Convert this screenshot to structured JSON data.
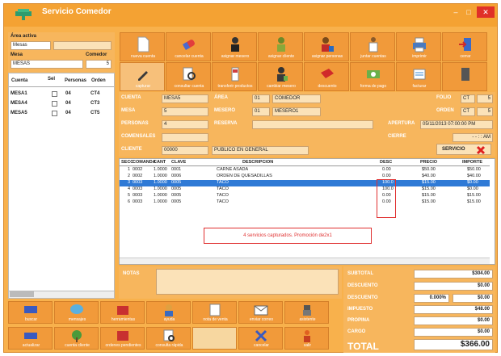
{
  "window": {
    "title": "Servicio Comedor",
    "min_glyph": "–",
    "max_glyph": "□",
    "close_glyph": "✕"
  },
  "left": {
    "area_label": "Área activa",
    "area_value": "Mesas",
    "mesa_label": "Mesa",
    "mesa_value": "MESAS",
    "config_label": "Comedor",
    "config_value": "5",
    "list_headers": [
      "Cuenta",
      "Sel",
      "Personas",
      "Orden"
    ],
    "accounts": [
      {
        "cuenta": "MESA1",
        "personas": "04",
        "orden": "CT4"
      },
      {
        "cuenta": "MESA4",
        "personas": "04",
        "orden": "CT3"
      },
      {
        "cuenta": "MESA5",
        "personas": "04",
        "orden": "CT5"
      }
    ]
  },
  "toolbar": {
    "row1": [
      {
        "name": "nuevo-button",
        "label": "nueva cuenta",
        "icon": "document-icon"
      },
      {
        "name": "borrar-button",
        "label": "cancelar cuenta",
        "icon": "eraser-icon"
      },
      {
        "name": "mesero-button",
        "label": "asignar mesero",
        "icon": "waiter-icon"
      },
      {
        "name": "cliente-button",
        "label": "asignar cliente",
        "icon": "customer-icon"
      },
      {
        "name": "personas-button",
        "label": "asignar personas",
        "icon": "people-icon"
      },
      {
        "name": "juntar-button",
        "label": "juntar cuentas",
        "icon": "merge-icon"
      },
      {
        "name": "imprimir-button",
        "label": "imprimir",
        "icon": "printer-icon"
      },
      {
        "name": "cerrar-button",
        "label": "cerrar",
        "icon": "exit-icon"
      }
    ],
    "row2": [
      {
        "name": "capturar-button",
        "label": "capturar",
        "icon": "pencil-icon"
      },
      {
        "name": "consultar-button",
        "label": "consultar cuenta",
        "icon": "search-doc-icon"
      },
      {
        "name": "transferir-button",
        "label": "transferir productos",
        "icon": "transfer-icon"
      },
      {
        "name": "cambiar-mesero-button",
        "label": "cambiar mesero",
        "icon": "waiter2-icon"
      },
      {
        "name": "descuento-button",
        "label": "descuento",
        "icon": "discount-icon"
      },
      {
        "name": "pagar-button",
        "label": "forma de pago",
        "icon": "payment-icon"
      },
      {
        "name": "factura-button",
        "label": "facturar",
        "icon": "invoice-icon"
      },
      {
        "name": "extra-button",
        "label": "",
        "icon": "door-icon"
      }
    ]
  },
  "info": {
    "cuenta_label": "CUENTA",
    "cuenta_value": "MESA5",
    "mesa_label": "MESA",
    "mesa_value": "5",
    "personas_label": "PERSONAS",
    "personas_value": "4",
    "comensales_label": "COMENSALES",
    "comensales_value": "",
    "cliente_label": "CLIENTE",
    "cliente_value": "00000",
    "cliente_name": "PUBLICO EN GENERAL",
    "area_label": "ÁREA",
    "area_code": "01",
    "area_name": "COMEDOR",
    "mesero_label": "MESERO",
    "mesero_code": "01",
    "mesero_name": "MESERO1",
    "reserva_label": "RESERVA",
    "reserva_value": "",
    "folio_label": "FOLIO",
    "folio_code": "CT",
    "folio_value": "5",
    "orden_label": "ORDEN",
    "orden_code": "CT",
    "orden_value": "5",
    "apertura_label": "APERTURA",
    "apertura_value": "05/11/2013 07:00:00 PM",
    "cierre_label": "CIERRE",
    "cierre_value": "- -   : : AM",
    "servicio_label": "SERVICIO"
  },
  "table": {
    "headers": [
      "SECC",
      "COMANDA",
      "CANT",
      "CLAVE",
      "DESCRIPCIÓN",
      "DESC",
      "PRECIO",
      "IMPORTE"
    ],
    "rows": [
      {
        "secc": "1",
        "comanda": "0002",
        "cant": "1.0000",
        "clave": "0001",
        "desc": "CARNE ASADA",
        "dsc": "0.00",
        "precio": "$50.00",
        "importe": "$50.00",
        "sel": false
      },
      {
        "secc": "2",
        "comanda": "0002",
        "cant": "1.0000",
        "clave": "0006",
        "desc": "ORDEN DE QUESADILLAS",
        "dsc": "0.00",
        "precio": "$40.00",
        "importe": "$40.00",
        "sel": false
      },
      {
        "secc": "3",
        "comanda": "0003",
        "cant": "1.0000",
        "clave": "0005",
        "desc": "TACO",
        "dsc": "100.0",
        "precio": "$15.00",
        "importe": "$0.00",
        "sel": true
      },
      {
        "secc": "4",
        "comanda": "0003",
        "cant": "1.0000",
        "clave": "0005",
        "desc": "TACO",
        "dsc": "100.0",
        "precio": "$15.00",
        "importe": "$0.00",
        "sel": false
      },
      {
        "secc": "5",
        "comanda": "0003",
        "cant": "1.0000",
        "clave": "0005",
        "desc": "TACO",
        "dsc": "0.00",
        "precio": "$15.00",
        "importe": "$15.00",
        "sel": false
      },
      {
        "secc": "6",
        "comanda": "0003",
        "cant": "1.0000",
        "clave": "0005",
        "desc": "TACO",
        "dsc": "0.00",
        "precio": "$15.00",
        "importe": "$15.00",
        "sel": false
      }
    ],
    "annotation": "4 servicios capturados. Promoción de2x1"
  },
  "notes": {
    "label": "NOTAS",
    "value": ""
  },
  "totals": {
    "subtotal_label": "SUBTOTAL",
    "subtotal_value": "$304.00",
    "descuento_label": "DESCUENTO",
    "descuento_value": "$0.00",
    "desc_label": "DESCUENTO",
    "desc_pct": "0.000%",
    "desc_value": "$0.00",
    "impuesto_label": "IMPUESTO",
    "impuesto_value": "$48.00",
    "propina_label": "PROPINA",
    "propina_value": "$0.00",
    "cargo_label": "CARGO",
    "cargo_value": "$0.00",
    "total_label": "TOTAL",
    "total_value": "$366.00"
  },
  "bottom": {
    "row1": [
      {
        "name": "buscar-button",
        "label": "buscar",
        "icon": "search-icon"
      },
      {
        "name": "mensajes-button",
        "label": "mensajes",
        "icon": "chat-icon"
      },
      {
        "name": "herramientas-button",
        "label": "herramientas",
        "icon": "toolbox-icon"
      },
      {
        "name": "ayuda-button",
        "label": "ayuda",
        "icon": "help-icon"
      },
      {
        "name": "notas-button",
        "label": "nota de venta",
        "icon": "note-icon"
      },
      {
        "name": "correo-button",
        "label": "enviar correo",
        "icon": "mail-icon"
      },
      {
        "name": "robot-button",
        "label": "asistente",
        "icon": "robot-icon"
      }
    ],
    "row2": [
      {
        "name": "actualizar-button",
        "label": "actualizar",
        "icon": "refresh-icon"
      },
      {
        "name": "cuenta-cliente-button",
        "label": "cuenta cliente",
        "icon": "tree-icon"
      },
      {
        "name": "ordenes-button",
        "label": "ordenes pendientes",
        "icon": "orders-icon"
      },
      {
        "name": "consulta-button",
        "label": "consulta rápida",
        "icon": "magnify-icon"
      },
      {
        "name": "blank-button",
        "label": "",
        "icon": ""
      },
      {
        "name": "cancelar-button",
        "label": "cancelar",
        "icon": "x-icon"
      },
      {
        "name": "salir-button",
        "label": "salir",
        "icon": "person-exit-icon"
      }
    ]
  },
  "colors": {
    "orange": "#f19a3a",
    "panel": "#f7b65d",
    "field": "#fbe2b8",
    "select": "#2f7ad6",
    "red": "#e03028"
  }
}
